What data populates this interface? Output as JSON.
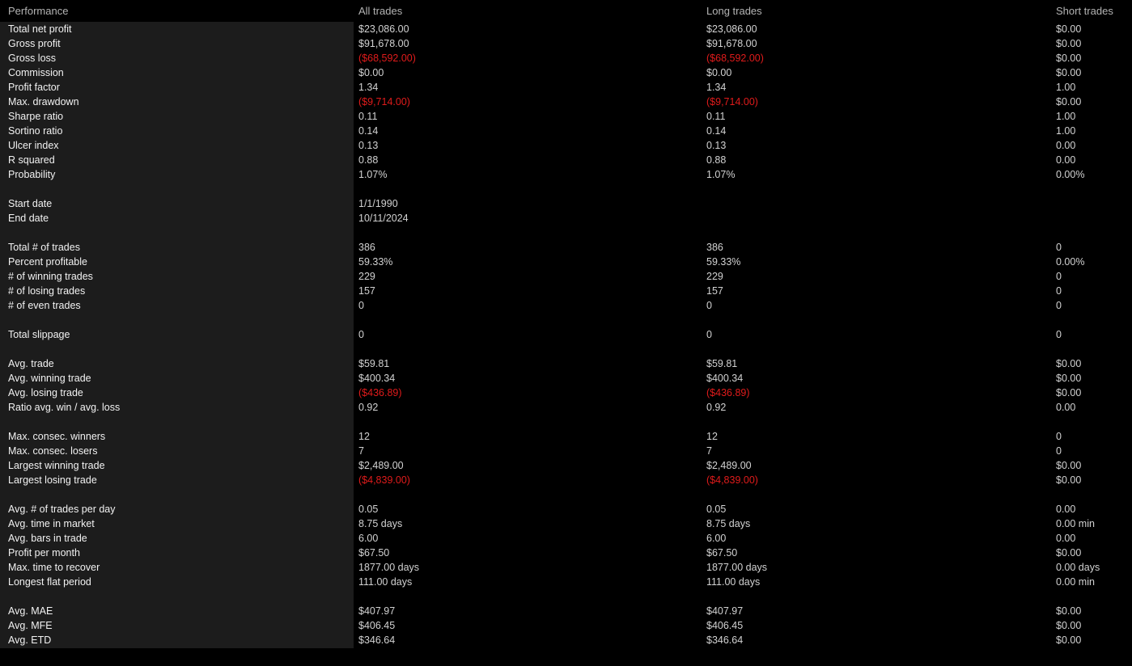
{
  "report": {
    "columns": {
      "label": "Performance",
      "all": "All trades",
      "long": "Long trades",
      "short": "Short trades"
    },
    "colors": {
      "background": "#000000",
      "label_panel": "#1c1c1c",
      "label_text": "#f2f2f2",
      "value_text": "#d2d2d2",
      "header_text": "#b4b4b4",
      "negative": "#e01b1b"
    },
    "sections": [
      {
        "rows": [
          {
            "label": "Total net profit",
            "all": "$23,086.00",
            "long": "$23,086.00",
            "short": "$0.00",
            "all_neg": false,
            "long_neg": false,
            "short_neg": false
          },
          {
            "label": "Gross profit",
            "all": "$91,678.00",
            "long": "$91,678.00",
            "short": "$0.00",
            "all_neg": false,
            "long_neg": false,
            "short_neg": false
          },
          {
            "label": "Gross loss",
            "all": "($68,592.00)",
            "long": "($68,592.00)",
            "short": "$0.00",
            "all_neg": true,
            "long_neg": true,
            "short_neg": false
          },
          {
            "label": "Commission",
            "all": "$0.00",
            "long": "$0.00",
            "short": "$0.00",
            "all_neg": false,
            "long_neg": false,
            "short_neg": false
          },
          {
            "label": "Profit factor",
            "all": "1.34",
            "long": "1.34",
            "short": "1.00",
            "all_neg": false,
            "long_neg": false,
            "short_neg": false
          },
          {
            "label": "Max. drawdown",
            "all": "($9,714.00)",
            "long": "($9,714.00)",
            "short": "$0.00",
            "all_neg": true,
            "long_neg": true,
            "short_neg": false
          },
          {
            "label": "Sharpe ratio",
            "all": "0.11",
            "long": "0.11",
            "short": "1.00",
            "all_neg": false,
            "long_neg": false,
            "short_neg": false
          },
          {
            "label": "Sortino ratio",
            "all": "0.14",
            "long": "0.14",
            "short": "1.00",
            "all_neg": false,
            "long_neg": false,
            "short_neg": false
          },
          {
            "label": "Ulcer index",
            "all": "0.13",
            "long": "0.13",
            "short": "0.00",
            "all_neg": false,
            "long_neg": false,
            "short_neg": false
          },
          {
            "label": "R squared",
            "all": "0.88",
            "long": "0.88",
            "short": "0.00",
            "all_neg": false,
            "long_neg": false,
            "short_neg": false
          },
          {
            "label": "Probability",
            "all": "1.07%",
            "long": "1.07%",
            "short": "0.00%",
            "all_neg": false,
            "long_neg": false,
            "short_neg": false
          }
        ]
      },
      {
        "rows": [
          {
            "label": "Start date",
            "all": "1/1/1990",
            "long": "",
            "short": "",
            "all_neg": false,
            "long_neg": false,
            "short_neg": false
          },
          {
            "label": "End date",
            "all": "10/11/2024",
            "long": "",
            "short": "",
            "all_neg": false,
            "long_neg": false,
            "short_neg": false
          }
        ]
      },
      {
        "rows": [
          {
            "label": "Total # of trades",
            "all": "386",
            "long": "386",
            "short": "0",
            "all_neg": false,
            "long_neg": false,
            "short_neg": false
          },
          {
            "label": "Percent profitable",
            "all": "59.33%",
            "long": "59.33%",
            "short": "0.00%",
            "all_neg": false,
            "long_neg": false,
            "short_neg": false
          },
          {
            "label": "# of winning trades",
            "all": "229",
            "long": "229",
            "short": "0",
            "all_neg": false,
            "long_neg": false,
            "short_neg": false
          },
          {
            "label": "# of losing trades",
            "all": "157",
            "long": "157",
            "short": "0",
            "all_neg": false,
            "long_neg": false,
            "short_neg": false
          },
          {
            "label": "# of even trades",
            "all": "0",
            "long": "0",
            "short": "0",
            "all_neg": false,
            "long_neg": false,
            "short_neg": false
          }
        ]
      },
      {
        "rows": [
          {
            "label": "Total slippage",
            "all": "0",
            "long": "0",
            "short": "0",
            "all_neg": false,
            "long_neg": false,
            "short_neg": false
          }
        ]
      },
      {
        "rows": [
          {
            "label": "Avg. trade",
            "all": "$59.81",
            "long": "$59.81",
            "short": "$0.00",
            "all_neg": false,
            "long_neg": false,
            "short_neg": false
          },
          {
            "label": "Avg. winning trade",
            "all": "$400.34",
            "long": "$400.34",
            "short": "$0.00",
            "all_neg": false,
            "long_neg": false,
            "short_neg": false
          },
          {
            "label": "Avg. losing trade",
            "all": "($436.89)",
            "long": "($436.89)",
            "short": "$0.00",
            "all_neg": true,
            "long_neg": true,
            "short_neg": false
          },
          {
            "label": "Ratio avg. win / avg. loss",
            "all": "0.92",
            "long": "0.92",
            "short": "0.00",
            "all_neg": false,
            "long_neg": false,
            "short_neg": false
          }
        ]
      },
      {
        "rows": [
          {
            "label": "Max. consec. winners",
            "all": "12",
            "long": "12",
            "short": "0",
            "all_neg": false,
            "long_neg": false,
            "short_neg": false
          },
          {
            "label": "Max. consec. losers",
            "all": "7",
            "long": "7",
            "short": "0",
            "all_neg": false,
            "long_neg": false,
            "short_neg": false
          },
          {
            "label": "Largest winning trade",
            "all": "$2,489.00",
            "long": "$2,489.00",
            "short": "$0.00",
            "all_neg": false,
            "long_neg": false,
            "short_neg": false
          },
          {
            "label": "Largest losing trade",
            "all": "($4,839.00)",
            "long": "($4,839.00)",
            "short": "$0.00",
            "all_neg": true,
            "long_neg": true,
            "short_neg": false
          }
        ]
      },
      {
        "rows": [
          {
            "label": "Avg. # of trades per day",
            "all": "0.05",
            "long": "0.05",
            "short": "0.00",
            "all_neg": false,
            "long_neg": false,
            "short_neg": false
          },
          {
            "label": "Avg. time in market",
            "all": "8.75 days",
            "long": "8.75 days",
            "short": "0.00 min",
            "all_neg": false,
            "long_neg": false,
            "short_neg": false
          },
          {
            "label": "Avg. bars in trade",
            "all": "6.00",
            "long": "6.00",
            "short": "0.00",
            "all_neg": false,
            "long_neg": false,
            "short_neg": false
          },
          {
            "label": "Profit per month",
            "all": "$67.50",
            "long": "$67.50",
            "short": "$0.00",
            "all_neg": false,
            "long_neg": false,
            "short_neg": false
          },
          {
            "label": "Max. time to recover",
            "all": "1877.00 days",
            "long": "1877.00 days",
            "short": "0.00 days",
            "all_neg": false,
            "long_neg": false,
            "short_neg": false
          },
          {
            "label": "Longest flat period",
            "all": "111.00 days",
            "long": "111.00 days",
            "short": "0.00 min",
            "all_neg": false,
            "long_neg": false,
            "short_neg": false
          }
        ]
      },
      {
        "rows": [
          {
            "label": "Avg. MAE",
            "all": "$407.97",
            "long": "$407.97",
            "short": "$0.00",
            "all_neg": false,
            "long_neg": false,
            "short_neg": false
          },
          {
            "label": "Avg. MFE",
            "all": "$406.45",
            "long": "$406.45",
            "short": "$0.00",
            "all_neg": false,
            "long_neg": false,
            "short_neg": false
          },
          {
            "label": "Avg. ETD",
            "all": "$346.64",
            "long": "$346.64",
            "short": "$0.00",
            "all_neg": false,
            "long_neg": false,
            "short_neg": false
          }
        ]
      }
    ]
  }
}
